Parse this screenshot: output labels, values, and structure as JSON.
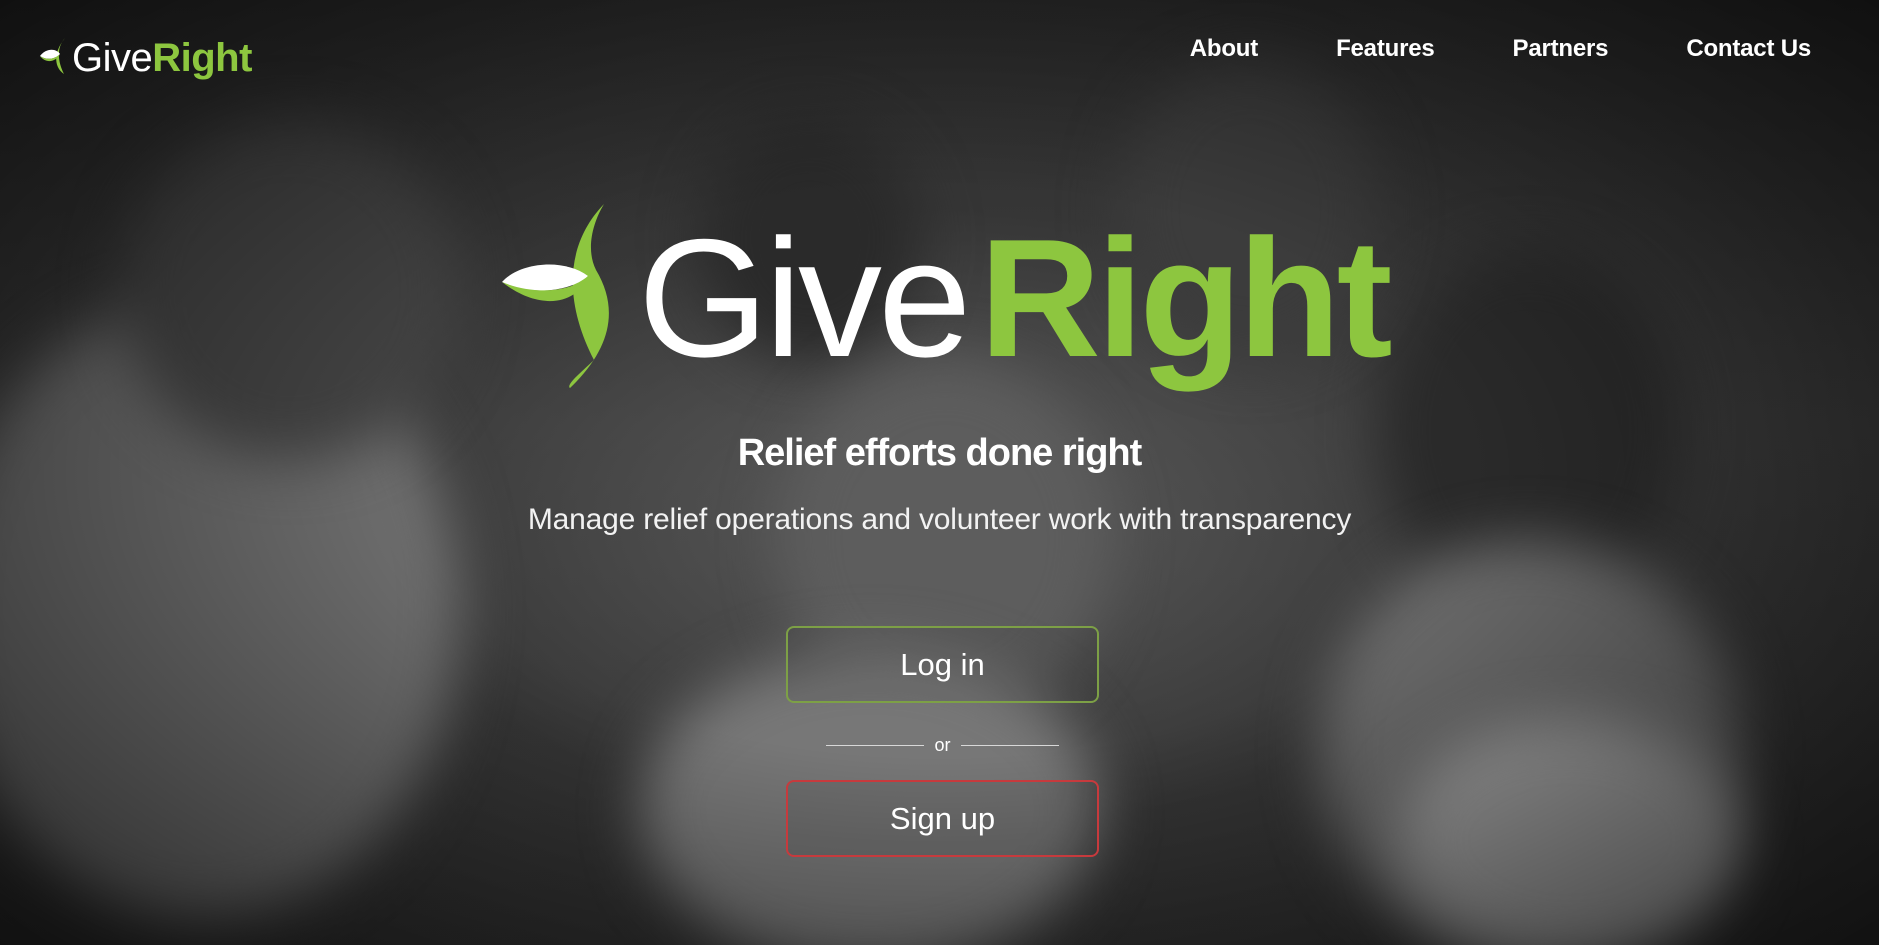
{
  "brand": {
    "give": "Give",
    "right": "Right",
    "colors": {
      "accent": "#8dc63f",
      "signup_border": "#c73a3d",
      "login_border": "#7da046"
    },
    "icon": "leaf-icon"
  },
  "nav": {
    "items": [
      {
        "label": "About"
      },
      {
        "label": "Features"
      },
      {
        "label": "Partners"
      },
      {
        "label": "Contact Us"
      }
    ]
  },
  "hero": {
    "tagline": "Relief efforts done right",
    "subtitle": "Manage relief operations and volunteer work with transparency"
  },
  "actions": {
    "login_label": "Log in",
    "separator": "or",
    "signup_label": "Sign up"
  }
}
